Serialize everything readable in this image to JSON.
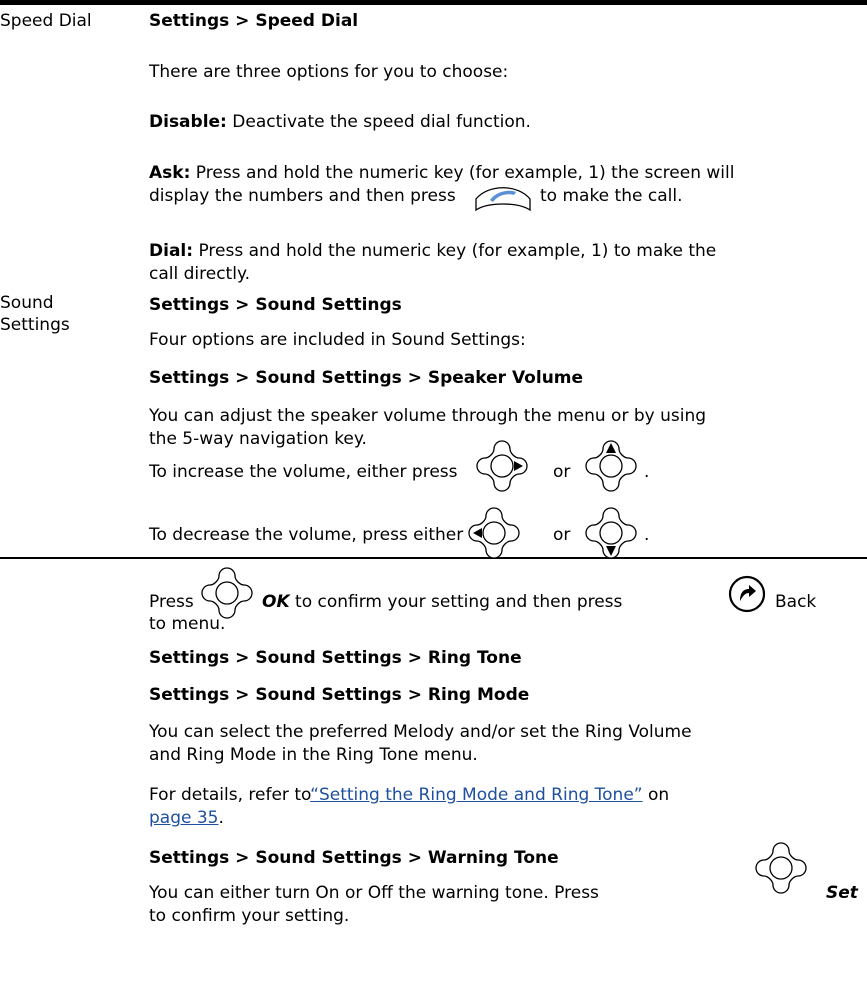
{
  "speed_dial": {
    "term": "Speed Dial",
    "heading": "Settings > Speed Dial",
    "intro": "There are three options for you to choose:",
    "disable_label": "Disable:",
    "disable_text": " Deactivate the speed dial function.",
    "ask_label": "Ask:",
    "ask_text_1": " Press and hold the numeric key (for example, 1) the screen will",
    "ask_text_2a": "display the numbers and then press",
    "ask_text_2b": "to make the call.",
    "dial_label": "Dial:",
    "dial_text_1": " Press and hold the numeric key (for example, 1) to make the",
    "dial_text_2": "call directly."
  },
  "sound_settings": {
    "term_line1": "Sound",
    "term_line2": "Settings",
    "heading": "Settings > Sound Settings",
    "intro": "Four options are included in Sound Settings:",
    "speaker_heading": "Settings > Sound Settings > Speaker Volume",
    "speaker_text_1": "You can adjust the speaker volume through the menu or by using",
    "speaker_text_2": "the 5-way navigation key.",
    "increase_text": "To increase the volume, either press",
    "decrease_text": "To decrease the volume, press either",
    "or_1": "or",
    "or_2": "or",
    "period_1": ".",
    "period_2": ".",
    "press_word": "Press",
    "ok_label": "OK",
    "confirm_text": "to confirm your setting and then press",
    "back_word": "Back",
    "to_menu": "to menu.",
    "ring_tone_heading": "Settings > Sound Settings > Ring Tone",
    "ring_mode_heading": "Settings > Sound Settings > Ring Mode",
    "ring_text_1": "You can select the preferred Melody and/or set the Ring Volume",
    "ring_text_2": "and Ring Mode in the Ring Tone menu.",
    "details_prefix": "For details, refer to",
    "details_link": "“Setting the Ring Mode and Ring Tone”",
    "details_on": " on",
    "page_link": "page 35",
    "page_period": ".",
    "warning_heading": "Settings > Sound Settings > Warning Tone",
    "warning_text_1": "You can either turn On or Off the warning tone. Press",
    "set_label": "Set",
    "warning_text_2": "to confirm your setting."
  },
  "icons": [
    "call-key-icon",
    "nav-right-icon",
    "nav-up-icon",
    "nav-left-icon",
    "nav-down-icon",
    "nav-center-ok-icon",
    "back-key-icon",
    "nav-center-set-icon"
  ],
  "colors": {
    "link": "#1f4fa0",
    "call_key_accent": "#5b8fd8"
  }
}
